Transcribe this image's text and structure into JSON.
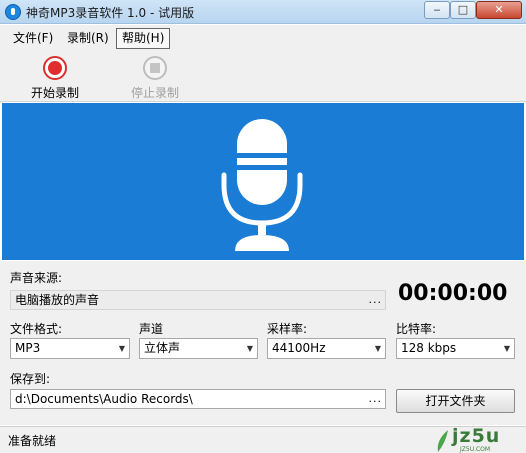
{
  "window": {
    "title": "神奇MP3录音软件 1.0 - 试用版",
    "min_glyph": "‒",
    "max_glyph": "□",
    "close_glyph": "✕"
  },
  "menu": {
    "file": "文件(F)",
    "record": "录制(R)",
    "help": "帮助(H)"
  },
  "toolbar": {
    "start_label": "开始录制",
    "stop_label": "停止录制"
  },
  "form": {
    "source_label": "声音来源:",
    "source_value": "电脑播放的声音",
    "browse_glyph": "...",
    "timer": "00:00:00",
    "format_label": "文件格式:",
    "format_value": "MP3",
    "channel_label": "声道",
    "channel_value": "立体声",
    "samplerate_label": "采样率:",
    "samplerate_value": "44100Hz",
    "bitrate_label": "比特率:",
    "bitrate_value": "128 kbps",
    "saveto_label": "保存到:",
    "saveto_value": "d:\\Documents\\Audio Records\\",
    "open_folder_label": "打开文件夹"
  },
  "status": {
    "text": "准备就绪"
  },
  "watermark": {
    "text": "jz5u",
    "sub": "JZ5U.COM"
  },
  "colors": {
    "banner": "#1a7cd5",
    "record_red": "#e02d2d"
  },
  "icons": [
    "app-icon",
    "record-icon",
    "stop-icon",
    "microphone-icon",
    "dropdown-arrow-icon"
  ]
}
